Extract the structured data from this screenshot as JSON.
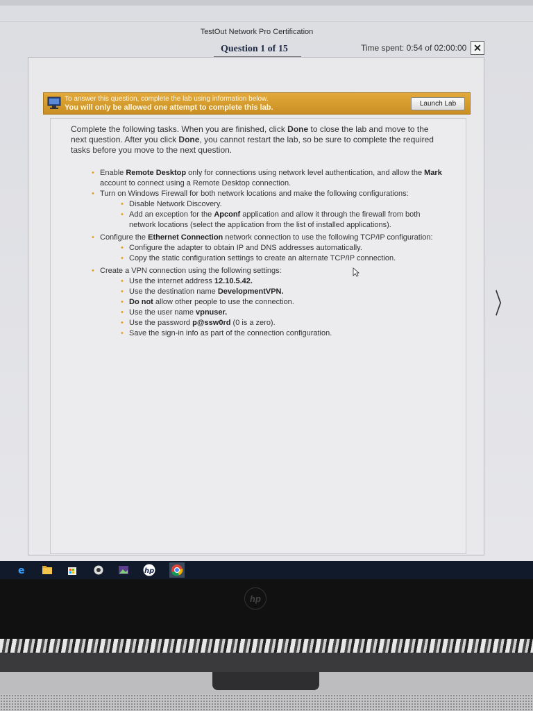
{
  "header": {
    "app_title": "TestOut Network Pro Certification",
    "question_label": "Question 1 of 15",
    "timer": "Time spent: 0:54 of 02:00:00",
    "close_symbol": "✕"
  },
  "banner": {
    "line1": "To answer this question, complete the lab using information below.",
    "line2": "You will only be allowed one attempt to complete this lab.",
    "launch_label": "Launch Lab"
  },
  "intro": {
    "t1": "Complete the following tasks. When you are finished, click ",
    "done1": "Done",
    "t2": " to close the lab and move to the next question. After you click ",
    "done2": "Done",
    "t3": ", you cannot restart the lab, so be sure to complete the required tasks before you move to the next question."
  },
  "tasks": {
    "t1": {
      "a": "Enable ",
      "b": "Remote Desktop",
      "c": " only for connections using network level authentication, and allow the ",
      "d": "Mark",
      "e": " account to connect using a Remote Desktop connection."
    },
    "t2": {
      "text": "Turn on Windows Firewall for both network locations and make the following configurations:",
      "s1": "Disable Network Discovery.",
      "s2a": "Add an exception for the ",
      "s2b": "Apconf",
      "s2c": " application and allow it through the firewall from both network locations (select the application from the list of installed applications)."
    },
    "t3": {
      "a": "Configure the ",
      "b": "Ethernet Connection",
      "c": " network connection to use the following TCP/IP configuration:",
      "s1": "Configure the adapter to obtain IP and DNS addresses automatically.",
      "s2": "Copy the static configuration settings to create an alternate TCP/IP connection."
    },
    "t4": {
      "text": "Create a VPN connection using the following settings:",
      "s1a": "Use the internet address ",
      "s1b": "12.10.5.42.",
      "s2a": "Use the destination name ",
      "s2b": "DevelopmentVPN.",
      "s3a": "Do not",
      "s3b": " allow other people to use the connection.",
      "s4a": "Use the user name ",
      "s4b": "vpnuser.",
      "s5a": "Use the password ",
      "s5b": "p@ssw0rd",
      "s5c": " (0 is a zero).",
      "s6": "Save the sign-in info as part of the connection configuration."
    }
  },
  "nav": {
    "next_symbol": "〉"
  },
  "taskbar": {
    "icons": [
      "edge-icon",
      "file-explorer-icon",
      "store-icon",
      "media-icon",
      "photos-icon",
      "hp-icon",
      "chrome-icon"
    ]
  },
  "laptop": {
    "logo_text": "hp"
  }
}
